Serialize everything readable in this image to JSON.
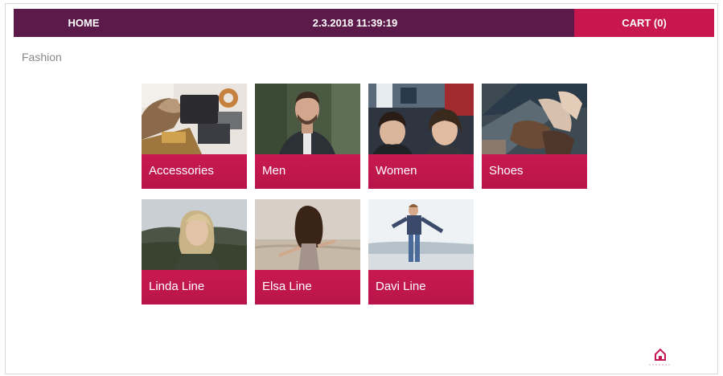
{
  "header": {
    "home_label": "HOME",
    "datetime": "2.3.2018 11:39:19",
    "cart_label": "CART (0)"
  },
  "page": {
    "title": "Fashion"
  },
  "categories": [
    {
      "label": "Accessories",
      "image": "accessories-photo"
    },
    {
      "label": "Men",
      "image": "men-portrait-photo"
    },
    {
      "label": "Women",
      "image": "women-portrait-photo"
    },
    {
      "label": "Shoes",
      "image": "shoes-photo"
    },
    {
      "label": "Linda Line",
      "image": "linda-line-photo"
    },
    {
      "label": "Elsa Line",
      "image": "elsa-line-photo"
    },
    {
      "label": "Davi Line",
      "image": "davi-line-photo"
    }
  ],
  "footer": {
    "home_icon": "home-icon"
  },
  "colors": {
    "header_bg": "#5c1a4a",
    "accent": "#c8174f",
    "page_bg": "#ffffff",
    "title_text": "#888888"
  }
}
